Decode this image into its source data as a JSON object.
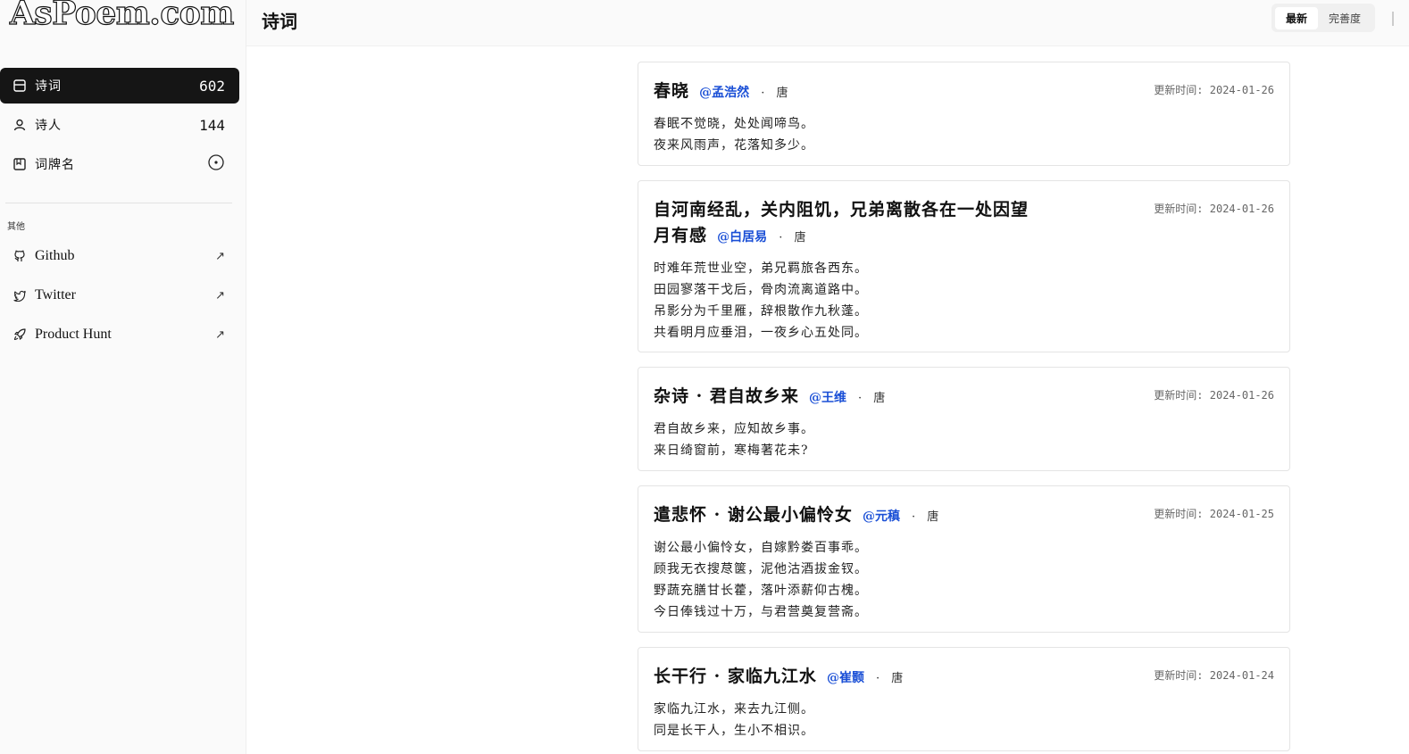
{
  "site": {
    "logo": "AsPoem.com"
  },
  "sidebar": {
    "nav": [
      {
        "label": "诗词",
        "count": "602",
        "icon": "list-icon",
        "active": true
      },
      {
        "label": "诗人",
        "count": "144",
        "icon": "person-icon",
        "active": false
      },
      {
        "label": "词牌名",
        "count": "",
        "icon": "bookmark-icon",
        "active": false
      }
    ],
    "section_label": "其他",
    "links": [
      {
        "label": "Github",
        "icon": "github-icon"
      },
      {
        "label": "Twitter",
        "icon": "twitter-icon"
      },
      {
        "label": "Product Hunt",
        "icon": "rocket-icon"
      }
    ]
  },
  "header": {
    "title": "诗词",
    "sort": {
      "latest": "最新",
      "completeness": "完善度",
      "selected": "最新"
    }
  },
  "colors": {
    "accent": "#151515",
    "author_link": "#1a4fd6"
  },
  "poems": [
    {
      "title": "春晓",
      "author": "@孟浩然",
      "separator": "·",
      "dynasty": "唐",
      "updated": "更新时间: 2024-01-26",
      "lines": [
        "春眠不觉晓，处处闻啼鸟。",
        "夜来风雨声，花落知多少。"
      ]
    },
    {
      "title": "自河南经乱，关内阻饥，兄弟离散各在一处因望月有感",
      "author": "@白居易",
      "separator": "·",
      "dynasty": "唐",
      "updated": "更新时间: 2024-01-26",
      "lines": [
        "时难年荒世业空，弟兄羁旅各西东。",
        "田园寥落干戈后，骨肉流离道路中。",
        "吊影分为千里雁，辞根散作九秋蓬。",
        "共看明月应垂泪，一夜乡心五处同。"
      ]
    },
    {
      "title": "杂诗 · 君自故乡来",
      "author": "@王维",
      "separator": "·",
      "dynasty": "唐",
      "updated": "更新时间: 2024-01-26",
      "lines": [
        "君自故乡来，应知故乡事。",
        "来日绮窗前，寒梅著花未?"
      ]
    },
    {
      "title": "遣悲怀 · 谢公最小偏怜女",
      "author": "@元稹",
      "separator": "·",
      "dynasty": "唐",
      "updated": "更新时间: 2024-01-25",
      "lines": [
        "谢公最小偏怜女，自嫁黔娄百事乖。",
        "顾我无衣搜荩箧，泥他沽酒拔金钗。",
        "野蔬充膳甘长藿，落叶添薪仰古槐。",
        "今日俸钱过十万，与君营奠复营斋。"
      ]
    },
    {
      "title": "长干行 · 家临九江水",
      "author": "@崔颢",
      "separator": "·",
      "dynasty": "唐",
      "updated": "更新时间: 2024-01-24",
      "lines": [
        "家临九江水，来去九江侧。",
        "同是长干人，生小不相识。"
      ]
    }
  ]
}
